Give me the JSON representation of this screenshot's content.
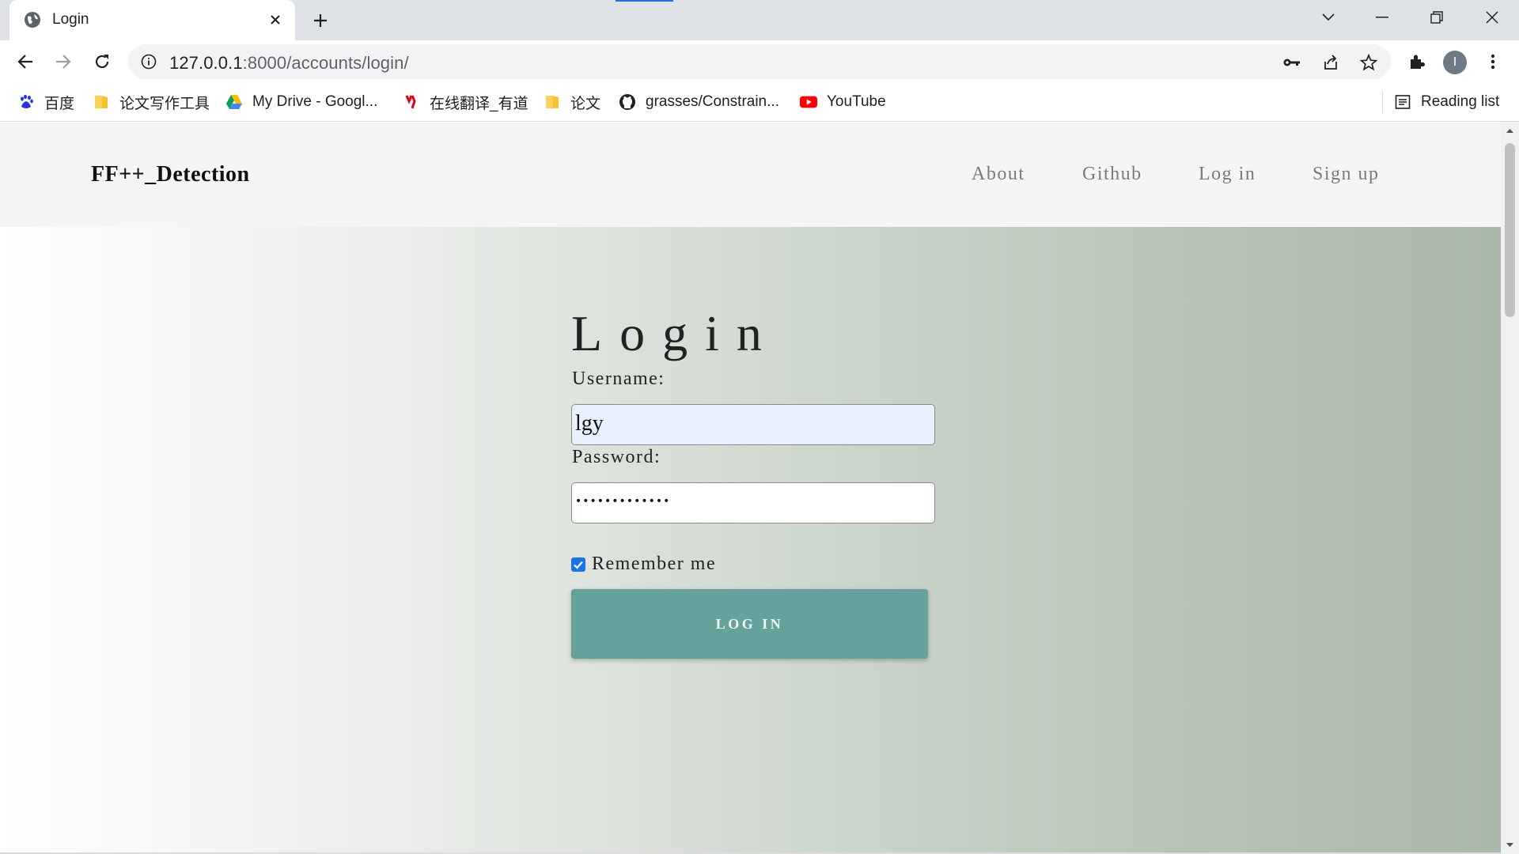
{
  "browser": {
    "tab": {
      "title": "Login",
      "favicon": "globe-icon"
    },
    "url": {
      "host": "127.0.0.1",
      "path": ":8000/accounts/login/"
    },
    "bookmarks": [
      {
        "label": "百度",
        "icon": "baidu-paw-icon"
      },
      {
        "label": "论文写作工具",
        "icon": "folder-icon"
      },
      {
        "label": "My Drive - Googl...",
        "icon": "google-drive-icon"
      },
      {
        "label": "在线翻译_有道",
        "icon": "youdao-icon"
      },
      {
        "label": "论文",
        "icon": "folder-icon"
      },
      {
        "label": "grasses/Constrain...",
        "icon": "github-icon"
      },
      {
        "label": "YouTube",
        "icon": "youtube-icon"
      }
    ],
    "reading_list": "Reading list",
    "profile_initial": "I",
    "colors": {
      "tabstrip": "#dee1e6",
      "accent": "#1a73e8"
    }
  },
  "site": {
    "brand": "FF++_Detection",
    "nav": [
      "About",
      "Github",
      "Log in",
      "Sign up"
    ]
  },
  "login": {
    "title": "Login",
    "username_label": "Username:",
    "username_value": "lgy",
    "password_label": "Password:",
    "password_value": "•••••••••••••",
    "remember_label": "Remember me",
    "remember_checked": true,
    "submit_label": "LOG IN",
    "colors": {
      "button": "#66a29c"
    }
  }
}
